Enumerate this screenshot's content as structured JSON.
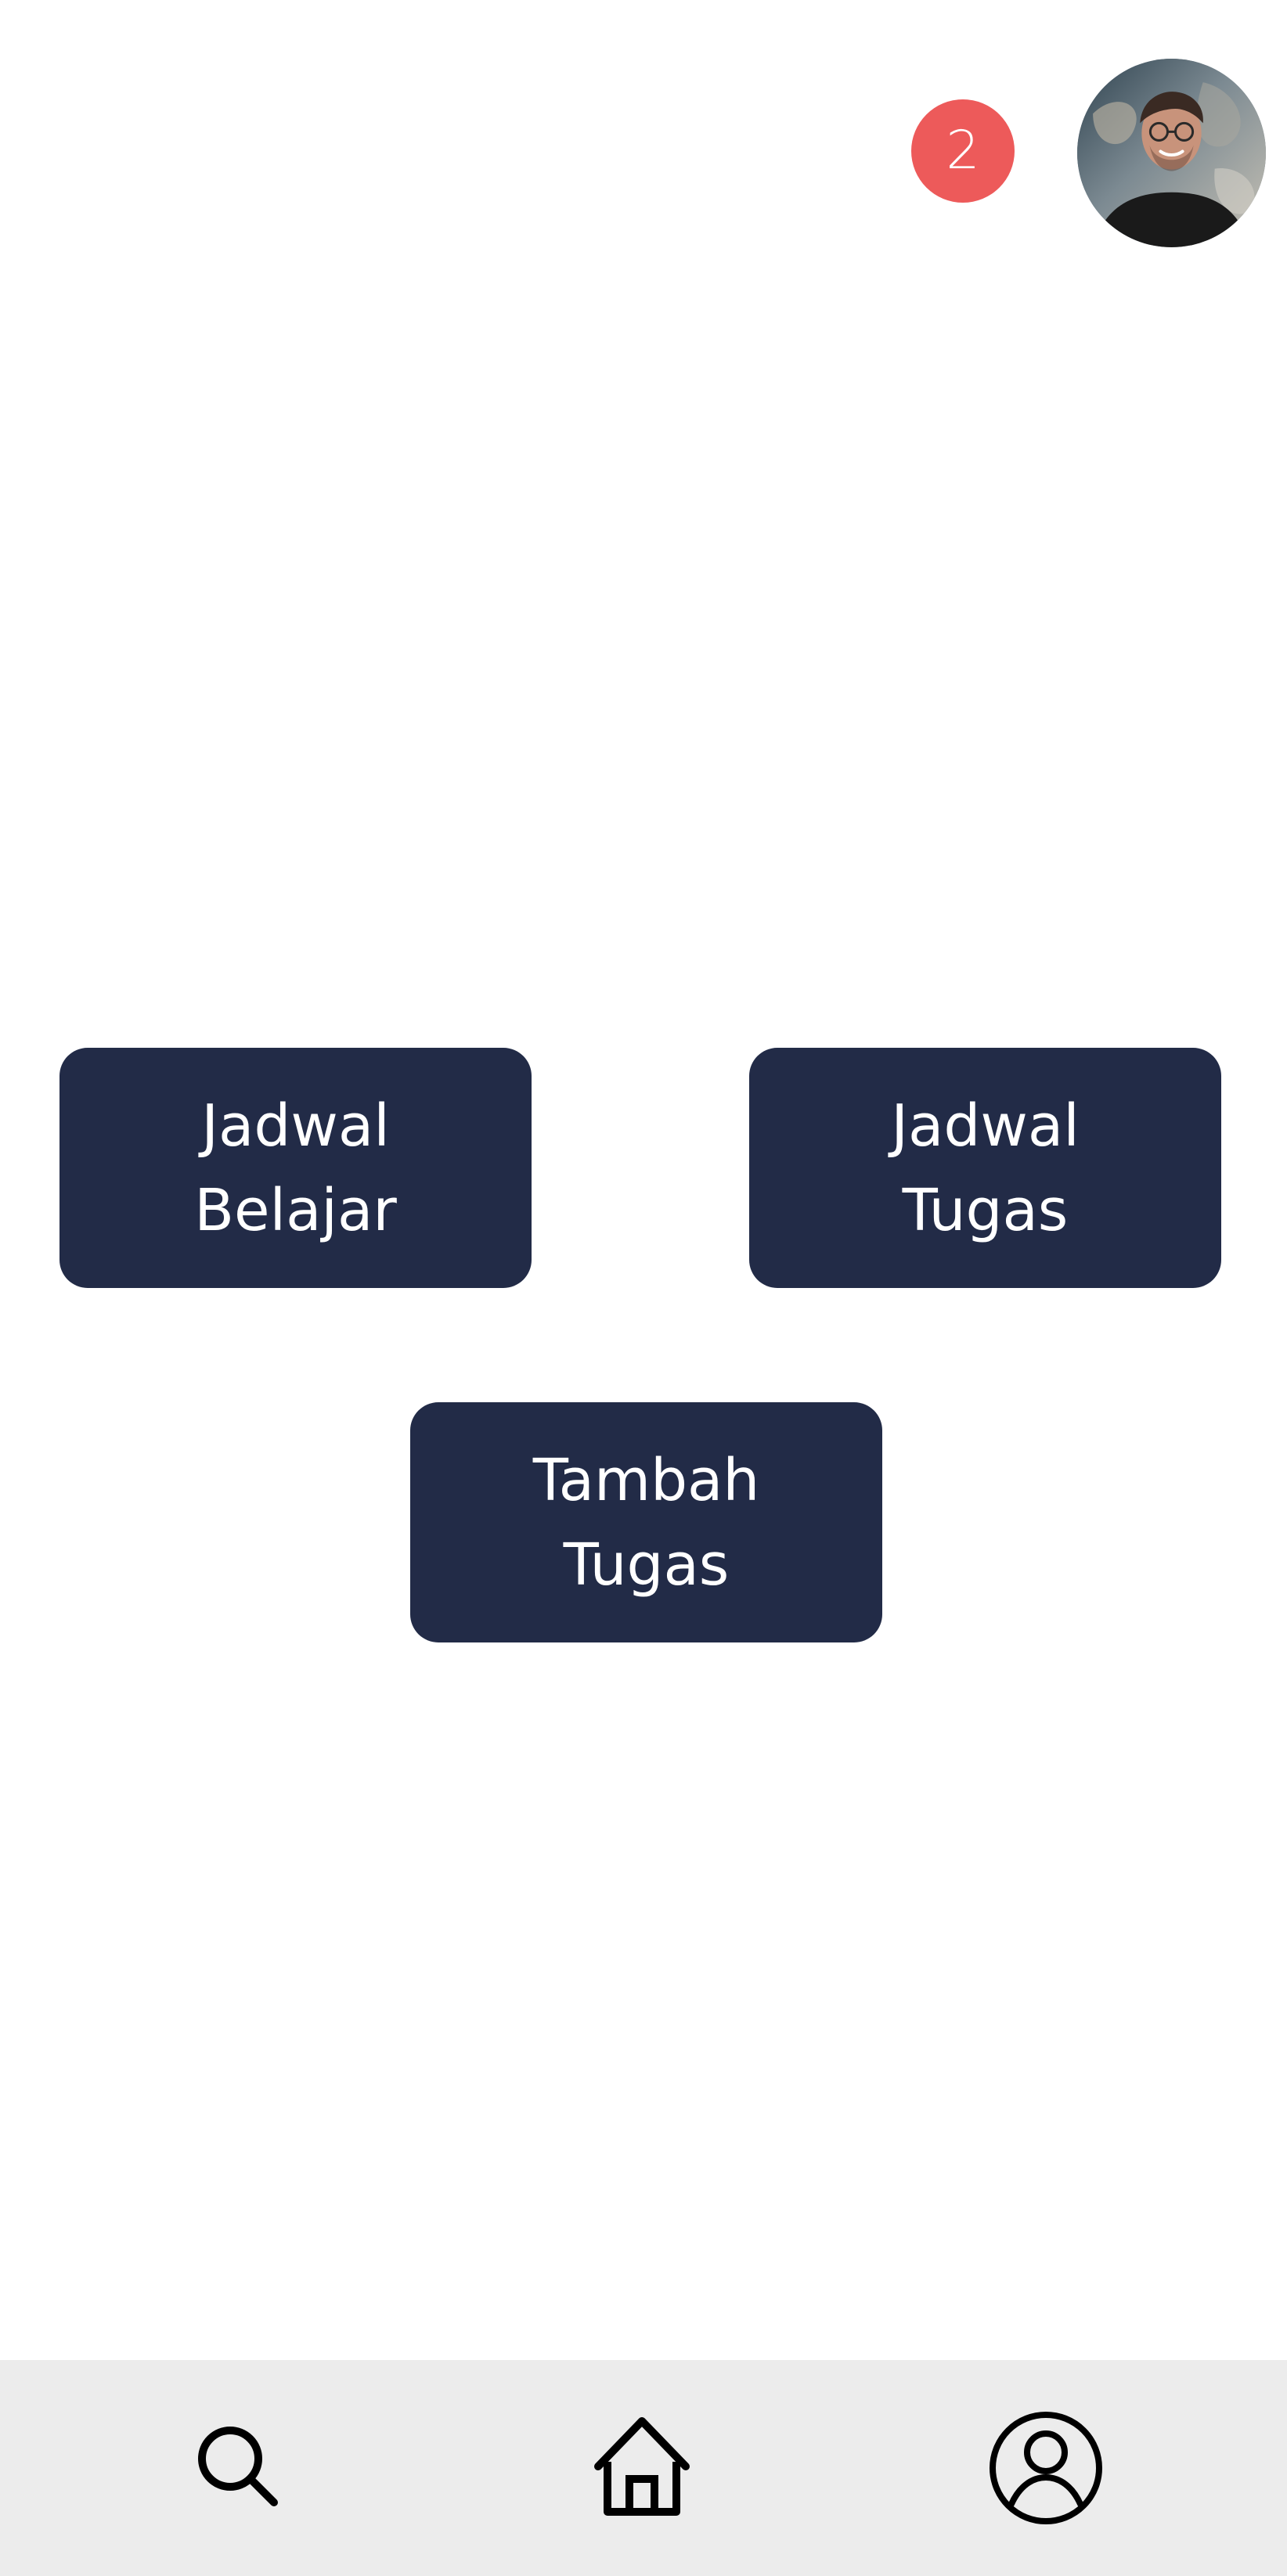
{
  "header": {
    "notification_count": "2",
    "avatar_icon": "user-avatar-photo"
  },
  "actions": [
    {
      "label": "Jadwal\nBelajar"
    },
    {
      "label": "Jadwal\nTugas"
    },
    {
      "label": "Tambah\nTugas"
    }
  ],
  "bottom_nav": {
    "items": [
      {
        "icon": "search-icon"
      },
      {
        "icon": "home-icon"
      },
      {
        "icon": "profile-icon"
      }
    ]
  },
  "colors": {
    "primary": "#222b47",
    "badge": "#ed5a5a",
    "nav_background": "#ececec",
    "background": "#ffffff"
  }
}
